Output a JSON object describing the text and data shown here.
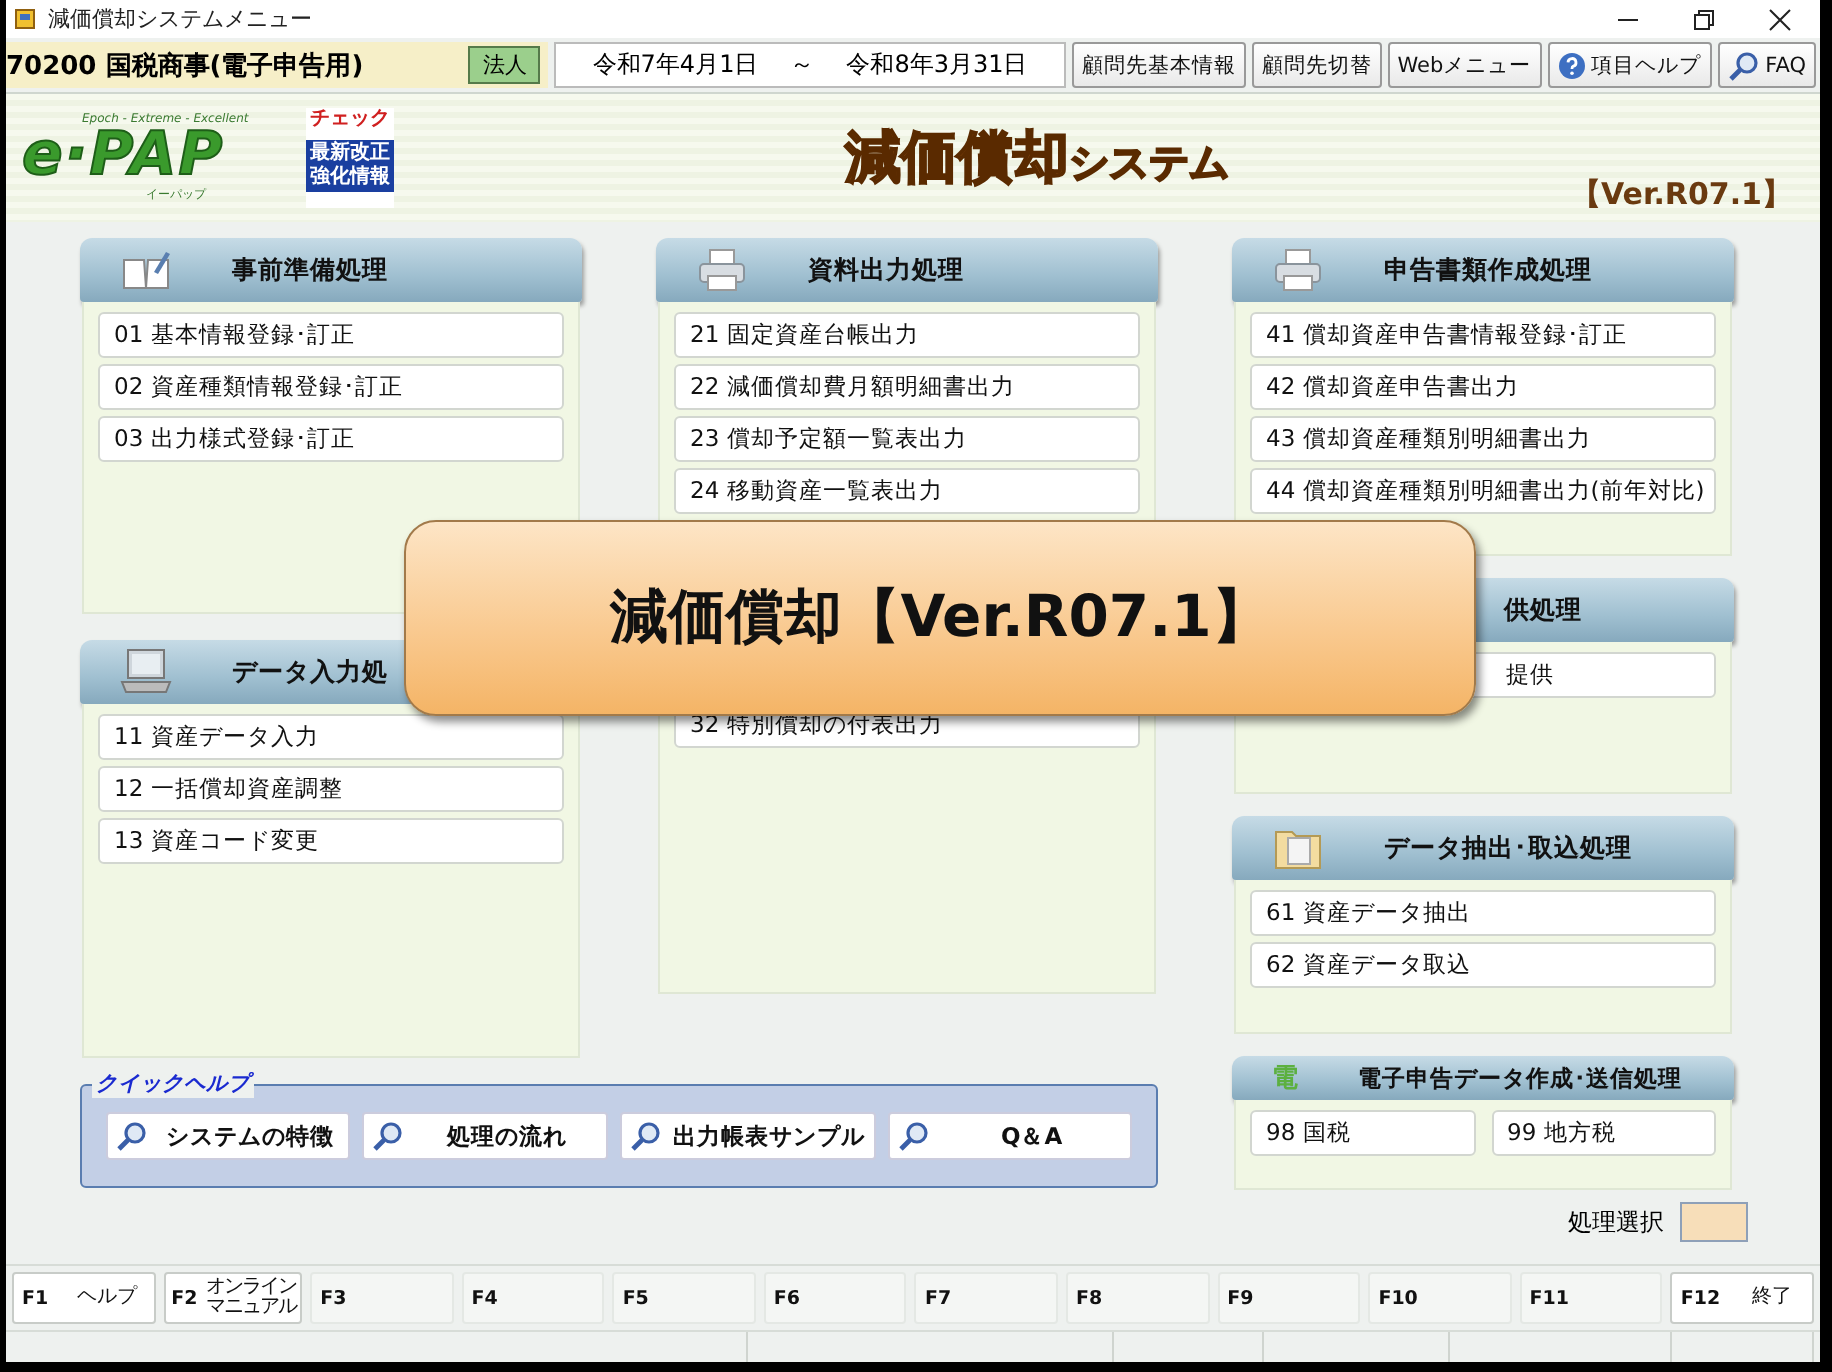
{
  "window": {
    "title": "減価償却システムメニュー"
  },
  "toolbar": {
    "company": "70200 国税商事(電子申告用)",
    "entity_type": "法人",
    "period_start": "令和7年4月1日",
    "period_separator": "～",
    "period_end": "令和8年3月31日",
    "buttons": [
      {
        "label": "顧問先基本情報"
      },
      {
        "label": "顧問先切替"
      },
      {
        "label": "Webメニュー"
      },
      {
        "label": "項目ヘルプ"
      },
      {
        "label": "FAQ"
      }
    ]
  },
  "banner": {
    "logo": {
      "text": "e·PAP",
      "tagline": "Epoch - Extreme - Excellent",
      "reading": "イーパップ"
    },
    "badge": {
      "title": "チェック",
      "lines": [
        "最新改正",
        "強化情報"
      ]
    },
    "title": "減価償却",
    "title_suffix": "システム",
    "version": "【Ver.R07.1】"
  },
  "columns": [
    {
      "panels": [
        {
          "title": "事前準備処理",
          "items": [
            {
              "label": "01 基本情報登録･訂正"
            },
            {
              "label": "02 資産種類情報登録･訂正"
            },
            {
              "label": "03 出力様式登録･訂正"
            }
          ]
        },
        {
          "title": "データ入力処",
          "items": [
            {
              "label": "11 資産データ入力"
            },
            {
              "label": "12 一括償却資産調整"
            },
            {
              "label": "13 資産コード変更"
            }
          ]
        }
      ]
    },
    {
      "panels": [
        {
          "title": "資料出力処理",
          "items": [
            {
              "label": "21 固定資産台帳出力"
            },
            {
              "label": "22 減価償却費月額明細書出力"
            },
            {
              "label": "23 償却予定額一覧表出力"
            },
            {
              "label": "24 移動資産一覧表出力"
            }
          ]
        },
        {
          "items": [
            {
              "label": "32 特別償却の付表出力"
            }
          ]
        }
      ]
    },
    {
      "panels": [
        {
          "title": "申告書類作成処理",
          "items": [
            {
              "label": "41 償却資産申告書情報登録･訂正"
            },
            {
              "label": "42 償却資産申告書出力"
            },
            {
              "label": "43 償却資産種類別明細書出力"
            },
            {
              "label": "44 償却資産種類別明細書出力(前年対比)"
            }
          ]
        },
        {
          "title": "供処理",
          "items": [
            {
              "label": "提供"
            }
          ]
        },
        {
          "title": "データ抽出･取込処理",
          "items": [
            {
              "label": "61 資産データ抽出"
            },
            {
              "label": "62 資産データ取込"
            }
          ]
        },
        {
          "title": "電子申告データ作成･送信処理",
          "icon_text": "電",
          "items": [
            {
              "label": "98 国税"
            },
            {
              "label": "99 地方税"
            }
          ]
        }
      ]
    }
  ],
  "quick_help": {
    "title": "クイックヘルプ",
    "buttons": [
      "システムの特徴",
      "処理の流れ",
      "出力帳表サンプル",
      "Q＆A"
    ]
  },
  "selection": {
    "label": "処理選択"
  },
  "function_keys": [
    {
      "key": "F1",
      "label": "ヘルプ"
    },
    {
      "key": "F2",
      "label": "オンラインマニュアル"
    },
    {
      "key": "F3"
    },
    {
      "key": "F4"
    },
    {
      "key": "F5"
    },
    {
      "key": "F6"
    },
    {
      "key": "F7"
    },
    {
      "key": "F8"
    },
    {
      "key": "F9"
    },
    {
      "key": "F10"
    },
    {
      "key": "F11"
    },
    {
      "key": "F12",
      "label": "終了"
    }
  ],
  "popup": {
    "text": "減価償却【Ver.R07.1】"
  }
}
